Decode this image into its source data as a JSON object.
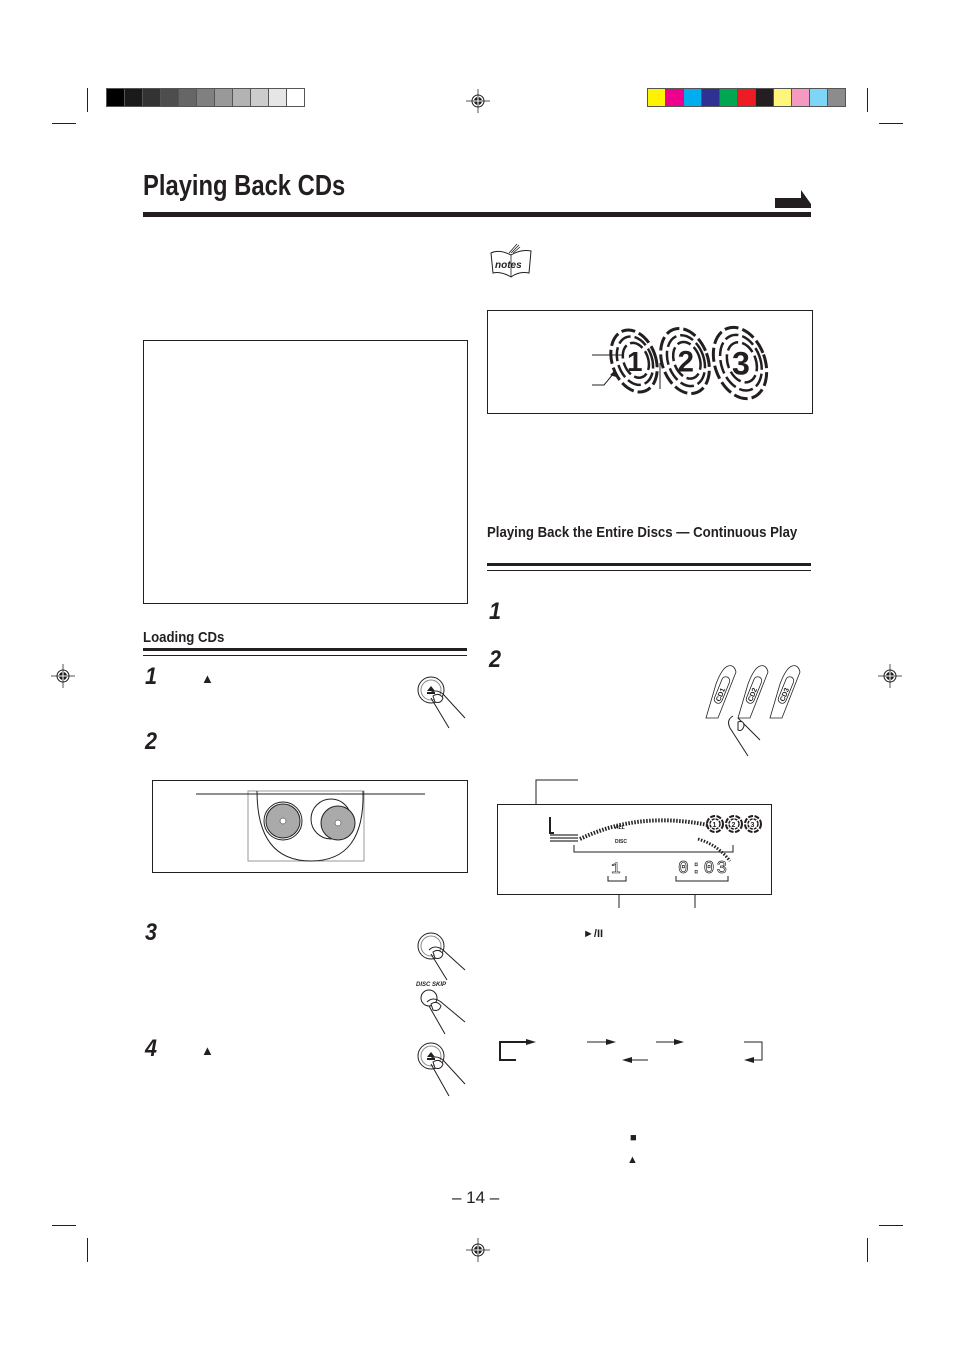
{
  "print_marks": {
    "grayscale_swatches": [
      "#000000",
      "#1a1a1a",
      "#333333",
      "#4d4d4d",
      "#666666",
      "#808080",
      "#999999",
      "#b3b3b3",
      "#cccccc",
      "#e6e6e6",
      "#ffffff"
    ],
    "color_swatches": [
      "#fff200",
      "#ec008c",
      "#00aeef",
      "#2e3192",
      "#00a651",
      "#ed1c24",
      "#231f20",
      "#fff57a",
      "#f49ac1",
      "#7dd6f8",
      "#8c8c8c"
    ],
    "registration_mark": "crosshair-target"
  },
  "page": {
    "title": "Playing Back CDs",
    "continue_icon": "continue-arrow",
    "page_number": "– 14 –"
  },
  "notes": {
    "icon": "notes-book-icon",
    "icon_label": "notes"
  },
  "disc_indicator_figure": {
    "discs": [
      "1",
      "2",
      "3"
    ]
  },
  "loading_section": {
    "heading": "Loading CDs",
    "steps": [
      {
        "number": "1",
        "symbol": "▲",
        "button_icon": "eject-button"
      },
      {
        "number": "2"
      },
      {
        "number": "3",
        "button_label": "DISC SKIP"
      },
      {
        "number": "4",
        "symbol": "▲",
        "button_icon": "eject-button"
      }
    ]
  },
  "continuous_section": {
    "heading": "Playing Back the Entire Discs — Continuous Play",
    "steps": [
      {
        "number": "1"
      },
      {
        "number": "2",
        "buttons": [
          "CD1",
          "CD2",
          "CD3"
        ]
      }
    ],
    "display": {
      "all_label": "ALL",
      "disc_label": "DISC",
      "disc_number": "1",
      "time": "0:03",
      "disc_icons": [
        "1",
        "2",
        "3"
      ]
    },
    "play_pause_symbol": "►/II",
    "stop_symbol": "■",
    "eject_symbol": "▲"
  }
}
